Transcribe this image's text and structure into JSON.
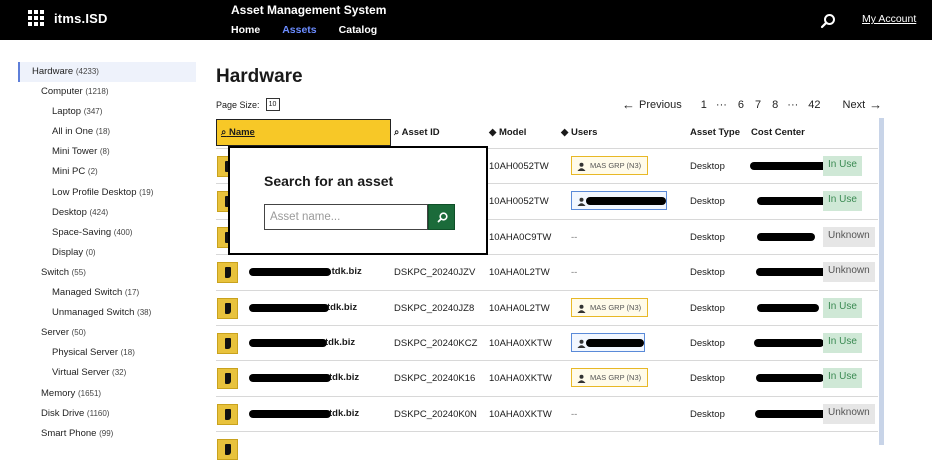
{
  "header": {
    "logo_text": "itms.ISD",
    "app_title": "Asset Management System",
    "nav": [
      "Home",
      "Assets",
      "Catalog"
    ],
    "active_nav": "Assets",
    "account_link": "My Account"
  },
  "sidebar": {
    "items": [
      {
        "label": "Hardware",
        "count": "(4233)",
        "level": 0,
        "active": true
      },
      {
        "label": "Computer",
        "count": "(1218)",
        "level": 1
      },
      {
        "label": "Laptop",
        "count": "(347)",
        "level": 2
      },
      {
        "label": "All in One",
        "count": "(18)",
        "level": 2
      },
      {
        "label": "Mini Tower",
        "count": "(8)",
        "level": 2
      },
      {
        "label": "Mini PC",
        "count": "(2)",
        "level": 2
      },
      {
        "label": "Low Profile Desktop",
        "count": "(19)",
        "level": 2
      },
      {
        "label": "Desktop",
        "count": "(424)",
        "level": 2
      },
      {
        "label": "Space-Saving",
        "count": "(400)",
        "level": 2
      },
      {
        "label": "Display",
        "count": "(0)",
        "level": 2
      },
      {
        "label": "Switch",
        "count": "(55)",
        "level": 1
      },
      {
        "label": "Managed Switch",
        "count": "(17)",
        "level": 2
      },
      {
        "label": "Unmanaged Switch",
        "count": "(38)",
        "level": 2
      },
      {
        "label": "Server",
        "count": "(50)",
        "level": 1
      },
      {
        "label": "Physical Server",
        "count": "(18)",
        "level": 2
      },
      {
        "label": "Virtual Server",
        "count": "(32)",
        "level": 2
      },
      {
        "label": "Memory",
        "count": "(1651)",
        "level": 1
      },
      {
        "label": "Disk Drive",
        "count": "(1160)",
        "level": 1
      },
      {
        "label": "Smart Phone",
        "count": "(99)",
        "level": 1
      }
    ]
  },
  "main": {
    "title": "Hardware",
    "page_size_label": "Page Size:",
    "page_size_value": "10",
    "pager": {
      "previous": "Previous",
      "next": "Next",
      "pages": [
        "1",
        "···",
        "6",
        "7",
        "8",
        "···",
        "42"
      ]
    }
  },
  "table": {
    "columns": [
      "Name",
      "Asset ID",
      "Model",
      "Users",
      "Asset Type",
      "Cost Center"
    ],
    "rows": [
      {
        "name": "",
        "asset_id": "",
        "model": "10AH0052TW",
        "user": "MAS GRP (N3)",
        "user_style": "group",
        "type": "Desktop",
        "status": "In Use"
      },
      {
        "name": "",
        "asset_id": "",
        "model": "10AH0052TW",
        "user": "",
        "user_style": "person",
        "type": "Desktop",
        "status": "In Use"
      },
      {
        "name": "",
        "asset_id": "",
        "model": "10AHA0C9TW",
        "user": "--",
        "user_style": "none",
        "type": "Desktop",
        "status": "Unknown"
      },
      {
        "name": ".tdk.biz",
        "asset_id": "DSKPC_20240JZV",
        "model": "10AHA0L2TW",
        "user": "--",
        "user_style": "none",
        "type": "Desktop",
        "status": "Unknown"
      },
      {
        "name": "tdk.biz",
        "asset_id": "DSKPC_20240JZ8",
        "model": "10AHA0L2TW",
        "user": "MAS GRP (N3)",
        "user_style": "group",
        "type": "Desktop",
        "status": "In Use"
      },
      {
        "name": "tdk.biz",
        "asset_id": "DSKPC_20240KCZ",
        "model": "10AHA0XKTW",
        "user": "",
        "user_style": "person",
        "type": "Desktop",
        "status": "In Use"
      },
      {
        "name": "tdk.biz",
        "asset_id": "DSKPC_20240K16",
        "model": "10AHA0XKTW",
        "user": "MAS GRP (N3)",
        "user_style": "group",
        "type": "Desktop",
        "status": "In Use"
      },
      {
        "name": "tdk.biz",
        "asset_id": "DSKPC_20240K0N",
        "model": "10AHA0XKTW",
        "user": "--",
        "user_style": "none",
        "type": "Desktop",
        "status": "Unknown"
      }
    ]
  },
  "popup": {
    "title": "Search for an asset",
    "placeholder": "Asset name..."
  },
  "colors": {
    "header_bg": "#000000",
    "active_nav": "#6b8cff",
    "name_header_bg": "#f7c827",
    "in_use_bg": "#cfe8d6",
    "unknown_bg": "#e6e6e6",
    "search_button": "#1b6b3a"
  }
}
